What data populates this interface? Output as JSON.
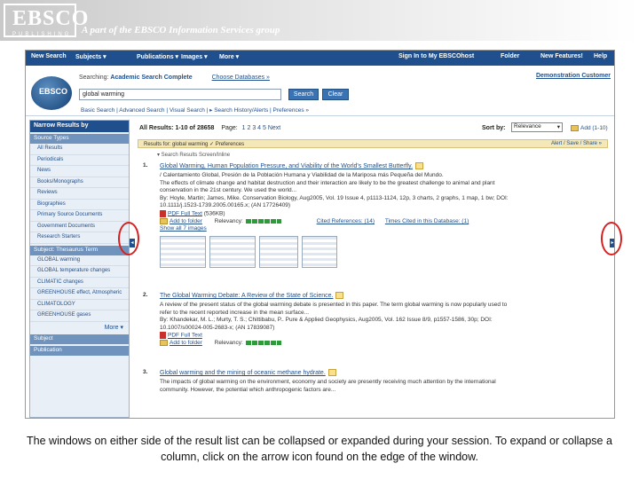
{
  "banner": {
    "logo_word": "EBSCO",
    "logo_sub": "PUBLISHING",
    "tagline": "A part of the EBSCO Information Services group"
  },
  "topnav": {
    "items": [
      "New Search",
      "Subjects ▾",
      "Publications ▾",
      "Images ▾",
      "More ▾"
    ],
    "right": [
      "Sign In to My EBSCOhost",
      "Folder",
      "New Features!",
      "Help"
    ]
  },
  "search": {
    "logo_text": "EBSCO",
    "searching_label": "Searching:",
    "database": "Academic Search Complete",
    "choose_db": "Choose Databases »",
    "query": "global warming",
    "search_btn": "Search",
    "clear_btn": "Clear",
    "sublinks": "Basic Search | Advanced Search | Visual Search | ▸ Search History/Alerts | Preferences »",
    "demo_link": "Demonstration Customer"
  },
  "left": {
    "header": "Narrow Results by",
    "source_types_label": "Source Types",
    "source_types": [
      "All Results",
      "Periodicals",
      "News",
      "Books/Monographs",
      "Reviews",
      "Biographies",
      "Primary Source Documents",
      "Government Documents",
      "Research Starters"
    ],
    "subject_label": "Subject: Thesaurus Term",
    "subjects": [
      "GLOBAL warming",
      "GLOBAL temperature changes",
      "CLIMATIC changes",
      "GREENHOUSE effect, Atmospheric",
      "CLIMATOLOGY",
      "GREENHOUSE gases"
    ],
    "more": "More ▾",
    "subject_section": "Subject",
    "publication_section": "Publication"
  },
  "results": {
    "summary": "All Results: 1-10 of 28658",
    "page_label": "Page:",
    "pages": "1  2  3  4  5  Next",
    "sort_label": "Sort by:",
    "sort_value": "Relevance",
    "add_link": "Add (1-10)",
    "narrow_bar": "Results for: global warming  ✓ Preferences",
    "alert_link": "Alert / Save / Share »",
    "relevance_line": "▾ Search Results Screen/Inline",
    "records": [
      {
        "num": "1.",
        "title": "Global Warming, Human Population Pressure, and Viability of the World's Smallest Butterfly.",
        "line1": "/ Calentamiento Global, Presión de la Población Humana y Viabilidad de la Mariposa más Pequeña del Mundo.",
        "line2": "The effects of climate change and habitat destruction and their interaction are likely to be the greatest challenge to animal and plant",
        "line3": "conservation in the 21st century. We used the world...",
        "line4": "By: Hoyle, Martin; James, Mike. Conservation Biology, Aug2005, Vol. 19 Issue 4, p1113-1124, 12p, 3 charts, 2 graphs, 1 map, 1 bw; DOI:",
        "line5": "10.1111/j.1523-1739.2005.00165.x; (AN 17726409)",
        "pdf": "PDF Full Text",
        "pdf_size": "(536KB)",
        "folder": "Add to folder",
        "relevancy": "Relevancy:",
        "cited": "Cited References: (14)",
        "times_cited": "Times Cited in this Database: (1)",
        "show_images": "Show all 7 images"
      },
      {
        "num": "2.",
        "title": "The Global Warming Debate: A Review of the State of Science.",
        "line1": "A review of the present status of the global warming debate is presented in this paper. The term global warming is now popularly used to",
        "line2": "refer to the recent reported increase in the mean surface...",
        "line3": "By: Khandekar, M. L.; Murty, T. S.; Chittibabu, P.. Pure & Applied Geophysics, Aug2005, Vol. 162 Issue 8/9, p1557-1586, 30p; DOI:",
        "line4": "10.1007/s00024-005-2683-x; (AN 17839087)",
        "pdf": "PDF Full Text",
        "folder": "Add to folder",
        "relevancy": "Relevancy:"
      },
      {
        "num": "3.",
        "title": "Global warming and the mining of oceanic methane hydrate.",
        "line1": "The impacts of global warming on the environment, economy and society are presently receiving much attention by the international",
        "line2": "community. However, the potential which anthropogenic factors are..."
      }
    ]
  },
  "caption": "The windows on either side of the result list can be collapsed or expanded during your session. To expand or collapse a column, click on the arrow icon found on the edge of the window."
}
